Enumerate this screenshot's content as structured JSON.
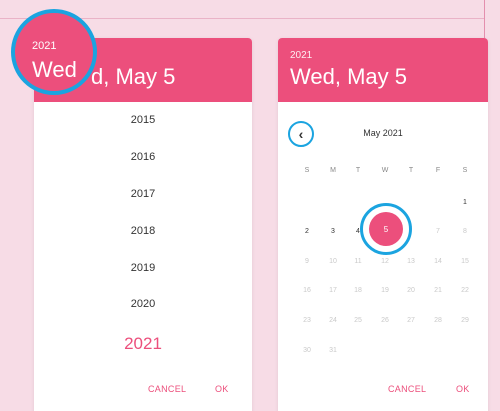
{
  "colors": {
    "accent": "#ec4f7c",
    "highlight": "#1ba4e0",
    "background": "#f7dce6"
  },
  "left_picker": {
    "header_year": "2021",
    "header_date": "Wed, May 5",
    "years": [
      "2015",
      "2016",
      "2017",
      "2018",
      "2019",
      "2020"
    ],
    "selected_year": "2021",
    "cancel_label": "CANCEL",
    "ok_label": "OK"
  },
  "right_picker": {
    "header_year": "2021",
    "header_date": "Wed, May 5",
    "month_label": "May 2021",
    "prev_icon": "chevron-left-icon",
    "weekdays": [
      "S",
      "M",
      "T",
      "W",
      "T",
      "F",
      "S"
    ],
    "rows": [
      [
        "",
        "",
        "",
        "",
        "",
        "",
        "1"
      ],
      [
        "2",
        "3",
        "4",
        "5",
        "7",
        "8"
      ],
      [
        "9",
        "10",
        "11",
        "12",
        "13",
        "14",
        "15"
      ],
      [
        "16",
        "17",
        "18",
        "19",
        "20",
        "21",
        "22"
      ],
      [
        "23",
        "24",
        "25",
        "26",
        "27",
        "28",
        "29"
      ],
      [
        "30",
        "31",
        "",
        "",
        "",
        "",
        ""
      ]
    ],
    "selected_day": "5",
    "cancel_label": "CANCEL",
    "ok_label": "OK"
  }
}
